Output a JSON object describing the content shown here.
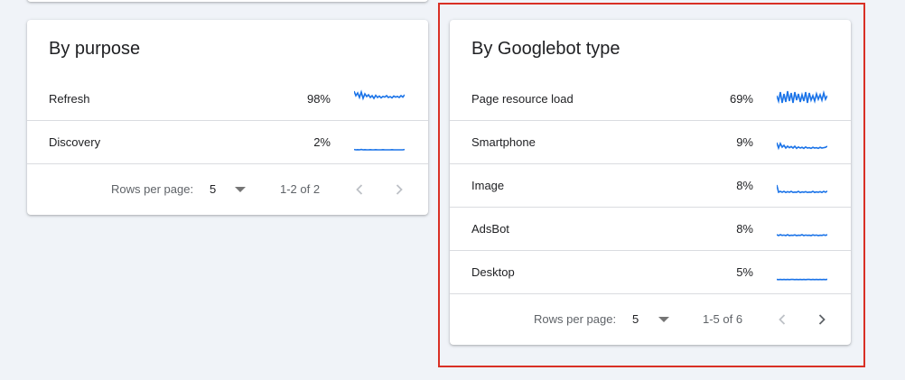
{
  "purpose": {
    "title": "By purpose",
    "rows": [
      {
        "label": "Refresh",
        "percent": "98%",
        "trend": [
          0.95,
          0.7,
          0.85,
          0.6,
          0.9,
          0.55,
          0.8,
          0.65,
          0.75,
          0.6,
          0.7,
          0.55,
          0.72,
          0.6,
          0.68,
          0.58,
          0.66,
          0.62,
          0.7,
          0.6,
          0.65,
          0.58,
          0.68,
          0.62,
          0.66,
          0.6,
          0.7,
          0.62,
          0.75
        ]
      },
      {
        "label": "Discovery",
        "percent": "2%",
        "trend": [
          0.12,
          0.1,
          0.11,
          0.1,
          0.12,
          0.1,
          0.11,
          0.1,
          0.1,
          0.11,
          0.1,
          0.1,
          0.11,
          0.1,
          0.1,
          0.1,
          0.11,
          0.1,
          0.1,
          0.1,
          0.1,
          0.11,
          0.1,
          0.1,
          0.1,
          0.1,
          0.1,
          0.1,
          0.12
        ]
      }
    ],
    "footer": {
      "rows_per_page_label": "Rows per page:",
      "rows_per_page_value": "5",
      "range": "1-2 of 2"
    }
  },
  "googlebot": {
    "title": "By Googlebot type",
    "rows": [
      {
        "label": "Page resource load",
        "percent": "69%",
        "trend": [
          0.7,
          0.4,
          0.9,
          0.3,
          0.8,
          0.35,
          0.95,
          0.4,
          0.85,
          0.3,
          0.9,
          0.45,
          0.8,
          0.35,
          0.75,
          0.4,
          0.9,
          0.3,
          0.85,
          0.45,
          0.7,
          0.4,
          0.8,
          0.5,
          0.75,
          0.45,
          0.85,
          0.5,
          0.7
        ]
      },
      {
        "label": "Smartphone",
        "percent": "9%",
        "trend": [
          0.5,
          0.2,
          0.45,
          0.25,
          0.35,
          0.2,
          0.3,
          0.22,
          0.28,
          0.2,
          0.3,
          0.18,
          0.26,
          0.2,
          0.24,
          0.18,
          0.26,
          0.2,
          0.22,
          0.18,
          0.24,
          0.2,
          0.22,
          0.18,
          0.24,
          0.2,
          0.22,
          0.24,
          0.3
        ]
      },
      {
        "label": "Image",
        "percent": "8%",
        "trend": [
          0.55,
          0.15,
          0.2,
          0.15,
          0.2,
          0.14,
          0.18,
          0.15,
          0.2,
          0.14,
          0.16,
          0.15,
          0.2,
          0.13,
          0.17,
          0.15,
          0.18,
          0.14,
          0.16,
          0.15,
          0.2,
          0.14,
          0.17,
          0.15,
          0.18,
          0.14,
          0.2,
          0.15,
          0.22
        ]
      },
      {
        "label": "AdsBot",
        "percent": "8%",
        "trend": [
          0.2,
          0.15,
          0.2,
          0.16,
          0.18,
          0.15,
          0.2,
          0.15,
          0.17,
          0.16,
          0.19,
          0.15,
          0.17,
          0.16,
          0.2,
          0.15,
          0.18,
          0.16,
          0.17,
          0.15,
          0.19,
          0.16,
          0.18,
          0.15,
          0.17,
          0.16,
          0.19,
          0.16,
          0.2
        ]
      },
      {
        "label": "Desktop",
        "percent": "5%",
        "trend": [
          0.12,
          0.11,
          0.12,
          0.11,
          0.12,
          0.11,
          0.12,
          0.11,
          0.12,
          0.12,
          0.11,
          0.12,
          0.11,
          0.12,
          0.11,
          0.12,
          0.11,
          0.12,
          0.12,
          0.11,
          0.12,
          0.11,
          0.12,
          0.11,
          0.12,
          0.11,
          0.12,
          0.11,
          0.13
        ]
      }
    ],
    "footer": {
      "rows_per_page_label": "Rows per page:",
      "rows_per_page_value": "5",
      "range": "1-5 of 6"
    }
  },
  "colors": {
    "sparkline": "#1a73e8",
    "highlight": "#d93025",
    "icon_enabled": "#5f6368",
    "icon_disabled": "#bdc1c6"
  },
  "icons": {
    "prev": "chevron-left-icon",
    "next": "chevron-right-icon",
    "dropdown": "arrow-drop-down-icon"
  }
}
